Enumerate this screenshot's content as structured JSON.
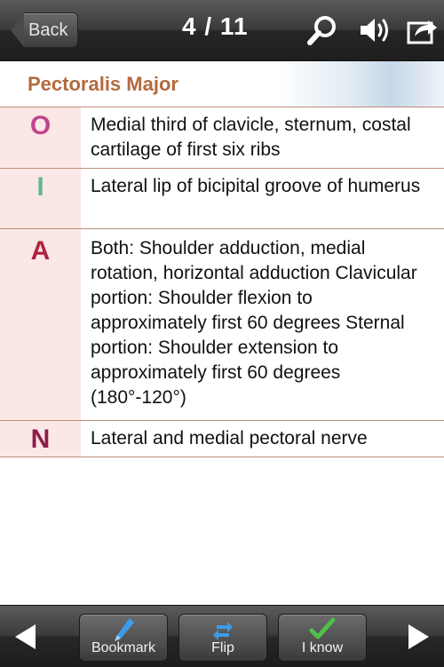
{
  "header": {
    "back_label": "Back",
    "counter": "4 / 11",
    "icons": [
      "search-icon",
      "speaker-icon",
      "share-icon"
    ]
  },
  "card": {
    "title": "Pectoralis Major",
    "rows": [
      {
        "letter": "O",
        "letter_color": "#c0448f",
        "text": "Medial third of clavicle, sternum, costal cartilage of first six ribs"
      },
      {
        "letter": "I",
        "letter_color": "#66b88a",
        "text": "Lateral lip of bicipital groove of humerus"
      },
      {
        "letter": "A",
        "letter_color": "#b0223e",
        "text": "Both: Shoulder adduction, medial rotation, horizontal adduction Clavicular portion: Shoulder flexion to approximately first 60 degrees Sternal portion: Shoulder extension to approximately first 60 degrees (180°-120°)"
      },
      {
        "letter": "N",
        "letter_color": "#8e1d49",
        "text": "Lateral and medial pectoral nerve"
      }
    ]
  },
  "toolbar": {
    "bookmark_label": "Bookmark",
    "flip_label": "Flip",
    "iknow_label": "I know",
    "icons": [
      "prev-arrow-icon",
      "bookmark-icon",
      "flip-icon",
      "checkmark-icon",
      "next-arrow-icon"
    ]
  },
  "colors": {
    "title": "#b36a3f",
    "divider": "#c08f7a",
    "letter_cell_bg": "#fbe8e6",
    "bar_dark": "#262626"
  }
}
